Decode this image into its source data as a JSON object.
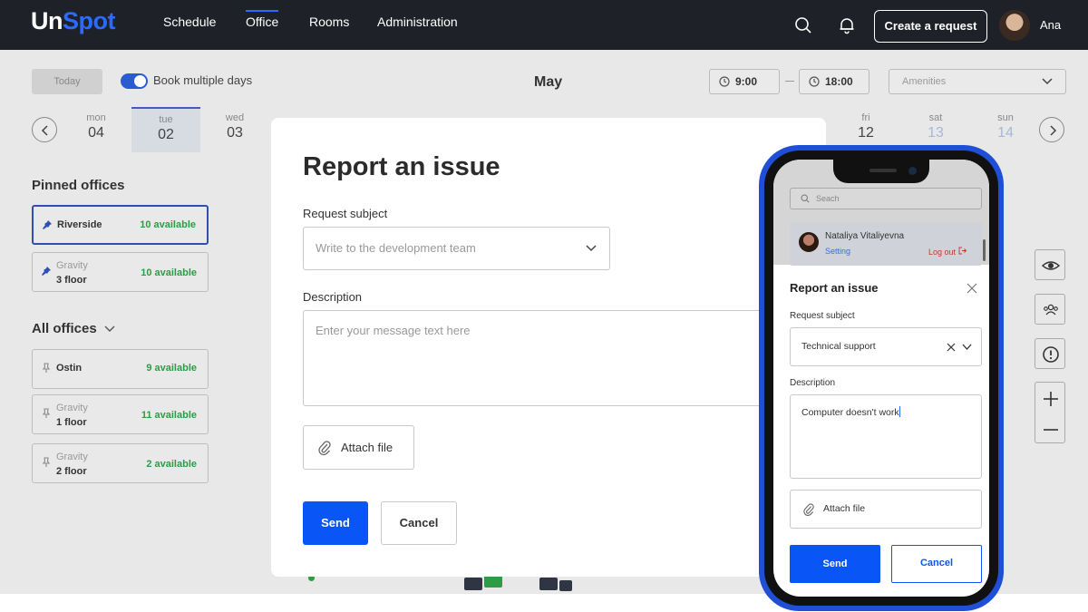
{
  "nav": {
    "logo_un": "Un",
    "logo_spot": "Spot",
    "links": [
      "Schedule",
      "Office",
      "Rooms",
      "Administration"
    ],
    "active_link": "Office",
    "create_request": "Create a request",
    "user_name": "Ana",
    "icons": [
      "search-icon",
      "bell-icon"
    ]
  },
  "toolbar": {
    "today": "Today",
    "book_multiple_days": "Book multiple days",
    "book_multiple_days_on": true,
    "month": "May",
    "time_from": "9:00",
    "time_to": "18:00",
    "amenities_placeholder": "Amenities"
  },
  "dates": [
    {
      "dow": "mon",
      "num": "04"
    },
    {
      "dow": "tue",
      "num": "02",
      "selected": true
    },
    {
      "dow": "wed",
      "num": "03"
    },
    {
      "dow": "fri",
      "num": "12"
    },
    {
      "dow": "sat",
      "num": "13",
      "weekend": true
    },
    {
      "dow": "sun",
      "num": "14",
      "weekend": true
    }
  ],
  "pinned": {
    "title": "Pinned offices",
    "items": [
      {
        "sub": "",
        "name": "Riverside",
        "available": "10 available",
        "active": true
      },
      {
        "sub": "Gravity",
        "name": "3 floor",
        "available": "10 available"
      }
    ]
  },
  "all_offices": {
    "title": "All offices",
    "items": [
      {
        "sub": "",
        "name": "Ostin",
        "available": "9 available"
      },
      {
        "sub": "Gravity",
        "name": "1 floor",
        "available": "11 available"
      },
      {
        "sub": "Gravity",
        "name": "2 floor",
        "available": "2 available"
      }
    ]
  },
  "modal": {
    "title": "Report an issue",
    "subject_label": "Request subject",
    "subject_placeholder": "Write to the development team",
    "description_label": "Description",
    "description_placeholder": "Enter your message text here",
    "attach": "Attach file",
    "send": "Send",
    "cancel": "Cancel"
  },
  "phone": {
    "search_placeholder": "Seach",
    "user_name": "Nataliya Vitaliyevna",
    "setting": "Setting",
    "logout": "Log out",
    "title": "Report an issue",
    "subject_label": "Request subject",
    "subject_value": "Technical support",
    "description_label": "Description",
    "description_value": "Computer doesn't work",
    "attach": "Attach file",
    "send": "Send",
    "cancel": "Cancel"
  },
  "colors": {
    "nav_bg": "#1f2128",
    "accent": "#0a55f5",
    "available": "#2e9b45",
    "phone_frame": "#1f4fd6"
  }
}
